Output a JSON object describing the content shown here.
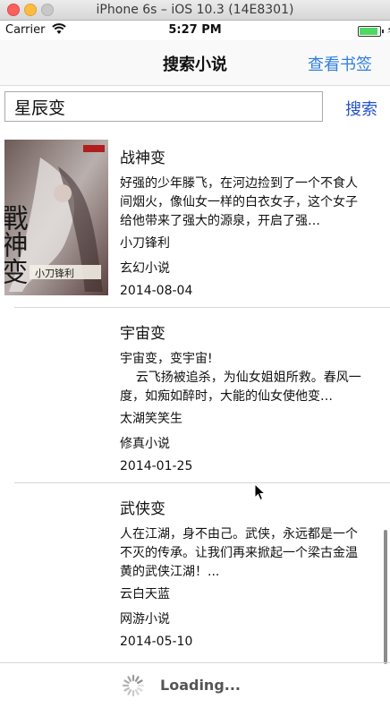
{
  "window": {
    "title": "iPhone 6s – iOS 10.3 (14E8301)"
  },
  "status_bar": {
    "carrier": "Carrier",
    "time": "5:27 PM",
    "battery_level": 0.84
  },
  "nav": {
    "title": "搜索小说",
    "right_button": "查看书签"
  },
  "search": {
    "value": "星辰变",
    "button": "搜索"
  },
  "books": [
    {
      "title": "战神变",
      "desc": "好强的少年滕飞，在河边捡到了一个不食人间烟火，像仙女一样的白衣女子，这个女子给他带来了强大的源泉，开启了强…",
      "author": "小刀锋利",
      "category": "玄幻小说",
      "date": "2014-08-04",
      "cover_text": "戰神变",
      "cover_author": "小刀锋利"
    },
    {
      "title": "宇宙变",
      "desc": "宇宙变，变宇宙!\n    云飞扬被追杀，为仙女姐姐所救。春风一度，如痴如醉时，大能的仙女使他变…",
      "author": "太湖笑笑生",
      "category": "修真小说",
      "date": "2014-01-25"
    },
    {
      "title": "武侠变",
      "desc": "人在江湖，身不由己。武侠，永远都是一个不灭的传承。让我们再来掀起一个梁古金温黄的武侠江湖！...",
      "author": "云白天蓝",
      "category": "网游小说",
      "date": "2014-05-10"
    }
  ],
  "loading": {
    "text": "Loading..."
  },
  "colors": {
    "link_blue": "#2f7fe0",
    "search_blue": "#2553c8"
  }
}
